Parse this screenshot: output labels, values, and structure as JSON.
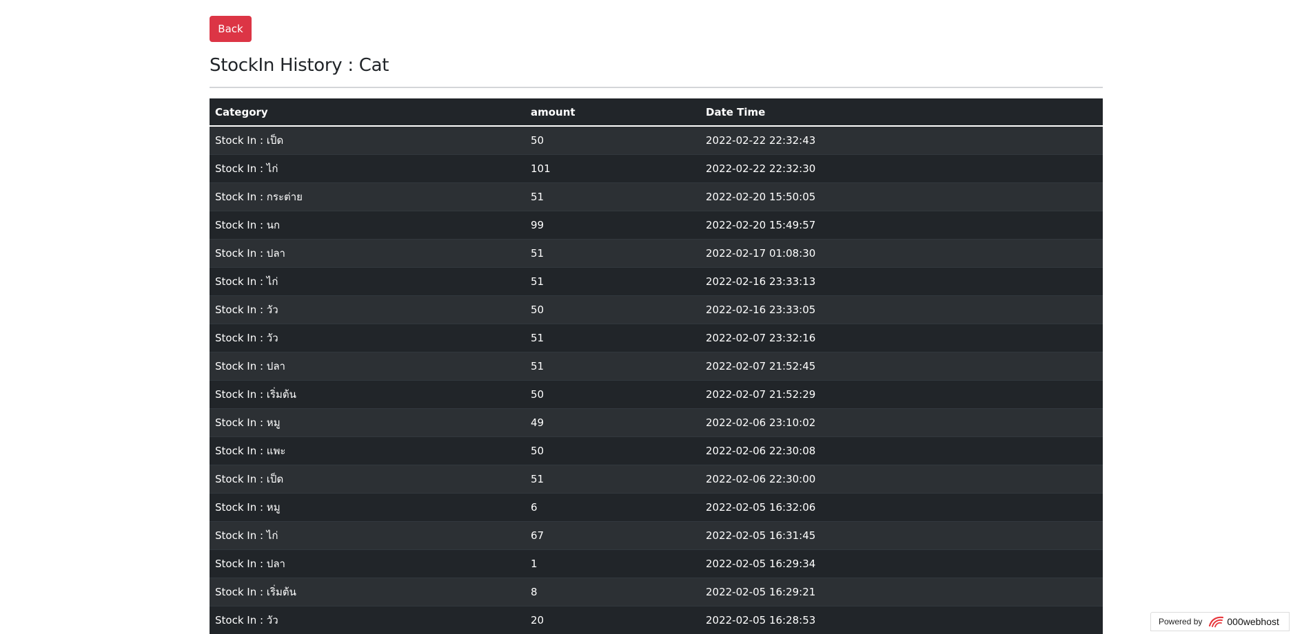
{
  "header": {
    "back_label": "Back",
    "title": "StockIn History : Cat"
  },
  "table": {
    "columns": [
      "Category",
      "amount",
      "Date Time"
    ],
    "rows": [
      {
        "category": "Stock In : เป็ด",
        "amount": "50",
        "datetime": "2022-02-22 22:32:43"
      },
      {
        "category": "Stock In : ไก่",
        "amount": "101",
        "datetime": "2022-02-22 22:32:30"
      },
      {
        "category": "Stock In : กระต่าย",
        "amount": "51",
        "datetime": "2022-02-20 15:50:05"
      },
      {
        "category": "Stock In : นก",
        "amount": "99",
        "datetime": "2022-02-20 15:49:57"
      },
      {
        "category": "Stock In : ปลา",
        "amount": "51",
        "datetime": "2022-02-17 01:08:30"
      },
      {
        "category": "Stock In : ไก่",
        "amount": "51",
        "datetime": "2022-02-16 23:33:13"
      },
      {
        "category": "Stock In : วัว",
        "amount": "50",
        "datetime": "2022-02-16 23:33:05"
      },
      {
        "category": "Stock In : วัว",
        "amount": "51",
        "datetime": "2022-02-07 23:32:16"
      },
      {
        "category": "Stock In : ปลา",
        "amount": "51",
        "datetime": "2022-02-07 21:52:45"
      },
      {
        "category": "Stock In : เริ่มต้น",
        "amount": "50",
        "datetime": "2022-02-07 21:52:29"
      },
      {
        "category": "Stock In : หมู",
        "amount": "49",
        "datetime": "2022-02-06 23:10:02"
      },
      {
        "category": "Stock In : แพะ",
        "amount": "50",
        "datetime": "2022-02-06 22:30:08"
      },
      {
        "category": "Stock In : เป็ด",
        "amount": "51",
        "datetime": "2022-02-06 22:30:00"
      },
      {
        "category": "Stock In : หมู",
        "amount": "6",
        "datetime": "2022-02-05 16:32:06"
      },
      {
        "category": "Stock In : ไก่",
        "amount": "67",
        "datetime": "2022-02-05 16:31:45"
      },
      {
        "category": "Stock In : ปลา",
        "amount": "1",
        "datetime": "2022-02-05 16:29:34"
      },
      {
        "category": "Stock In : เริ่มต้น",
        "amount": "8",
        "datetime": "2022-02-05 16:29:21"
      },
      {
        "category": "Stock In : วัว",
        "amount": "20",
        "datetime": "2022-02-05 16:28:53"
      }
    ]
  },
  "badge": {
    "powered_label": "Powered by",
    "brand_name": "000webhost",
    "logo_icon": "000webhost-logo-icon",
    "logo_color": "#e8383d"
  },
  "colors": {
    "back_button": "#dc3545",
    "table_header": "#212529",
    "row_odd": "#2c3034",
    "row_even": "#212529"
  }
}
